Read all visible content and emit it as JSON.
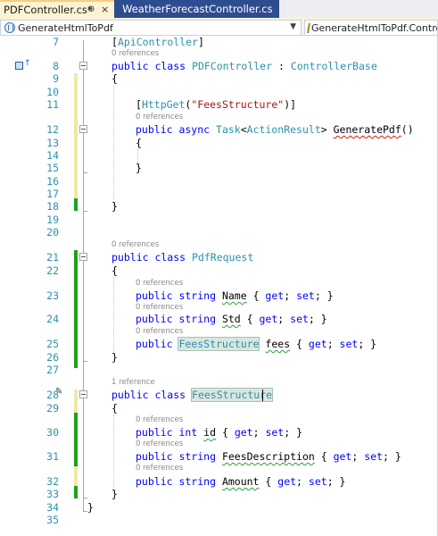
{
  "tabs": [
    {
      "name": "PDFController.cs*",
      "active": true,
      "pin": "⊕",
      "close": "×"
    },
    {
      "name": "WeatherForecastController.cs",
      "active": false
    }
  ],
  "navbar": {
    "left_combo": "GenerateHtmlToPdf",
    "right_combo": "GenerateHtmlToPdf.Controll"
  },
  "colors": {
    "keyword": "#0000ff",
    "type": "#2b91af",
    "string": "#a31515",
    "line_number": "#2b91af",
    "active_tab": "#fcf3d2",
    "inactive_tab": "#2e4d90",
    "change_saved": "#1aa31a",
    "change_unsaved": "#eee8a8"
  },
  "editor": {
    "line_numbers": [
      "7",
      "8",
      "9",
      "10",
      "11",
      "12",
      "13",
      "14",
      "15",
      "16",
      "17",
      "18",
      "19",
      "20",
      "21",
      "22",
      "23",
      "24",
      "25",
      "26",
      "27",
      "28",
      "29",
      "30",
      "31",
      "32",
      "33",
      "34",
      "35"
    ],
    "lens": {
      "pdfcontroller": "0 references",
      "generatepdf": "0 references",
      "pdfrequest": "0 references",
      "name": "0 references",
      "std": "0 references",
      "fees": "0 references",
      "feesstructure": "1 reference",
      "id": "0 references",
      "feesdescription": "0 references",
      "amount": "0 references"
    },
    "code": {
      "l7_open": "[",
      "l7_attr": "ApiController",
      "l7_close": "]",
      "l8_kw": "public class ",
      "l8_name": "PDFController",
      "l8_sep": " : ",
      "l8_base": "ControllerBase",
      "l9": "{",
      "l11_open": "[",
      "l11_attr": "HttpGet",
      "l11_paren": "(",
      "l11_str": "\"FeesStructure\"",
      "l11_close": ")]",
      "l12_kw": "public async ",
      "l12_task": "Task",
      "l12_lt": "<",
      "l12_ar": "ActionResult",
      "l12_gt": "> ",
      "l12_method": "GeneratePdf",
      "l12_parens": "()",
      "l13": "{",
      "l15": "}",
      "l18": "}",
      "l21_kw": "public class ",
      "l21_name": "PdfRequest",
      "l22": "{",
      "l23_kw": "public string ",
      "l23_prop": "Name",
      "l23_a": " { ",
      "l23_get": "get",
      "l23_b": "; ",
      "l23_set": "set",
      "l23_c": "; }",
      "l24_kw": "public string ",
      "l24_prop": "Std",
      "l24_a": " { ",
      "l24_get": "get",
      "l24_b": "; ",
      "l24_set": "set",
      "l24_c": "; }",
      "l25_kw": "public ",
      "l25_type": "FeesStructure",
      "l25_sp": " ",
      "l25_prop": "fees",
      "l25_a": " { ",
      "l25_get": "get",
      "l25_b": "; ",
      "l25_set": "set",
      "l25_c": "; }",
      "l26": "}",
      "l28_kw": "public class ",
      "l28_name": "FeesStructure",
      "l29": "{",
      "l30_kw": "public int ",
      "l30_prop": "id",
      "l30_a": " { ",
      "l30_get": "get",
      "l30_b": "; ",
      "l30_set": "set",
      "l30_c": "; }",
      "l31_kw": "public string ",
      "l31_prop": "FeesDescription",
      "l31_a": " { ",
      "l31_get": "get",
      "l31_b": "; ",
      "l31_set": "set",
      "l31_c": "; }",
      "l32_kw": "public string ",
      "l32_prop": "Amount",
      "l32_a": " { ",
      "l32_get": "get",
      "l32_b": "; ",
      "l32_set": "set",
      "l32_c": "; }",
      "l33": "}",
      "l34": "}"
    }
  }
}
